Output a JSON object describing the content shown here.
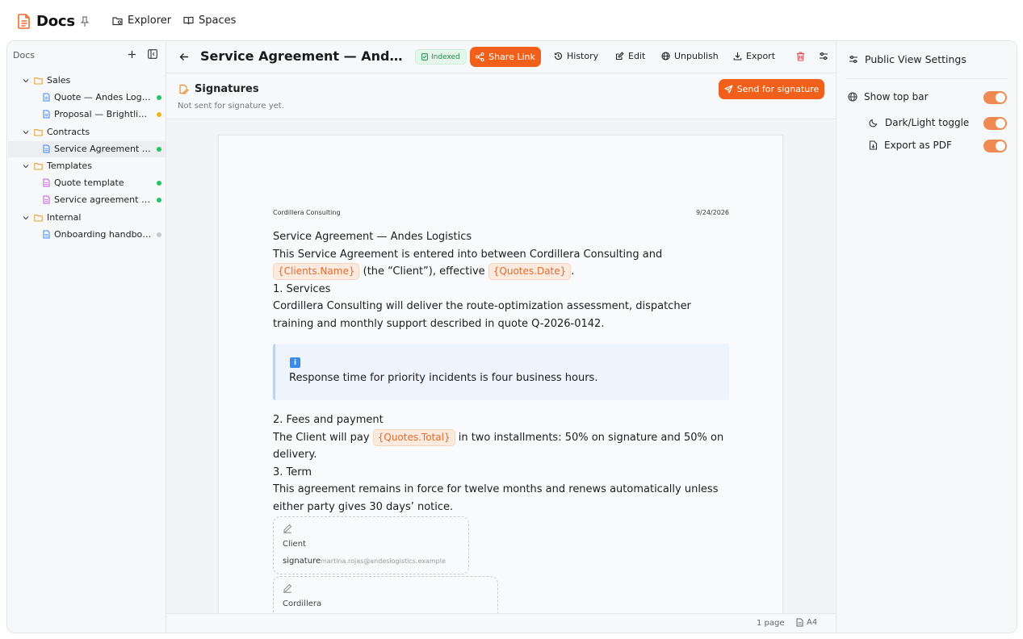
{
  "app": {
    "title": "Docs"
  },
  "topnav": {
    "explorer": "Explorer",
    "spaces": "Spaces"
  },
  "sidebar": {
    "header": "Docs",
    "tree": [
      {
        "label": "Sales",
        "type": "folder",
        "depth": 0
      },
      {
        "label": "Quote — Andes Logistics",
        "type": "doc",
        "depth": 1,
        "status": "#22c55e"
      },
      {
        "label": "Proposal — Brightline Studio",
        "type": "doc",
        "depth": 1,
        "status": "#f5b21b"
      },
      {
        "label": "Contracts",
        "type": "folder",
        "depth": 0
      },
      {
        "label": "Service Agreement — Andes Logistics",
        "type": "doc",
        "depth": 1,
        "status": "#22c55e",
        "selected": true
      },
      {
        "label": "Templates",
        "type": "folder",
        "depth": 0
      },
      {
        "label": "Quote template",
        "type": "template",
        "depth": 1,
        "status": "#22c55e"
      },
      {
        "label": "Service agreement template",
        "type": "template",
        "depth": 1,
        "status": "#22c55e"
      },
      {
        "label": "Internal",
        "type": "folder",
        "depth": 0
      },
      {
        "label": "Onboarding handbook",
        "type": "doc",
        "depth": 1,
        "status": "#c5c8cc"
      }
    ]
  },
  "document": {
    "title": "Service Agreement — Andes Logistics",
    "badge": "Indexed",
    "share_label": "Share Link",
    "toolbar": {
      "history": "History",
      "edit": "Edit",
      "unpublish": "Unpublish",
      "export": "Export"
    },
    "signatures": {
      "title": "Signatures",
      "status": "Not sent for signature yet.",
      "send_label": "Send for signature"
    },
    "page": {
      "company": "Cordillera Consulting",
      "date": "9/24/2026",
      "heading": "Service Agreement — Andes Logistics",
      "intro_a": "This Service Agreement is entered into between Cordillera Consulting and",
      "chip_client": "{Clients.Name}",
      "intro_b": " (the “Client”), effective ",
      "chip_date": "{Quotes.Date}",
      "intro_c": ".",
      "s1_title": "1. Services",
      "s1_text": "Cordillera Consulting will deliver the route-optimization assessment, dispatcher training and monthly support described in quote Q-2026-0142.",
      "callout_icon": "i",
      "callout": "Response time for priority incidents is four business hours.",
      "s2_title": "2. Fees and payment",
      "s2_a": "The Client will pay ",
      "chip_total": "{Quotes.Total}",
      "s2_b": " in two installments: 50% on signature and 50% on delivery.",
      "s3_title": "3. Term",
      "s3_text": "This agreement remains in force for twelve months and renews automatically unless either party gives 30 days’ notice.",
      "sig1_label": "Client",
      "sig1_word": "signature",
      "sig1_email": "martina.rojas@andeslogistics.example",
      "sig2_label": "Cordillera"
    },
    "status_bar": {
      "pages": "1 page",
      "size": "A4"
    }
  },
  "right_panel": {
    "title": "Public View Settings",
    "settings": [
      {
        "label": "Show top bar",
        "on": true
      },
      {
        "label": "Dark/Light toggle",
        "on": true
      },
      {
        "label": "Export as PDF",
        "on": true
      }
    ]
  },
  "colors": {
    "accent": "#f0601a",
    "toggle": "#ef8a52",
    "chip_bg": "#fdeadf",
    "callout_bg": "#edf4fd"
  }
}
